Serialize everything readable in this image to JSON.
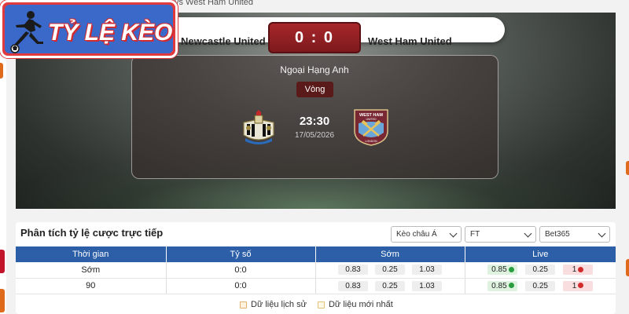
{
  "breadcrumb": "vs West Ham United",
  "logo": {
    "text": "TỶ LỆ KÈO"
  },
  "match": {
    "home_team": "Newcastle United",
    "away_team": "West Ham United",
    "score": "0 : 0",
    "league": "Ngoại Hạng Anh",
    "round": "Vòng",
    "time": "23:30",
    "date": "17/05/2026"
  },
  "analysis": {
    "title": "Phân tích tỷ lệ cược trực tiếp",
    "selects": [
      "Kèo châu Á",
      "FT",
      "Bet365"
    ],
    "headers": [
      "Thời gian",
      "Tỷ số",
      "Sớm",
      "Live"
    ],
    "rows": [
      {
        "time": "Sớm",
        "score": "0:0",
        "early": [
          "0.83",
          "0.25",
          "1.03"
        ],
        "live": [
          "0.85",
          "0.25",
          "1"
        ]
      },
      {
        "time": "90",
        "score": "0:0",
        "early": [
          "0.83",
          "0.25",
          "1.03"
        ],
        "live": [
          "0.85",
          "0.25",
          "1"
        ]
      }
    ],
    "legend": [
      "Dữ liệu lịch sử",
      "Dữ liệu mới nhất"
    ]
  },
  "colors": {
    "header_blue": "#2c5fa8",
    "score_red": "#a7262a",
    "logo_blue": "#3b69c9",
    "logo_red": "#e03a3e"
  }
}
